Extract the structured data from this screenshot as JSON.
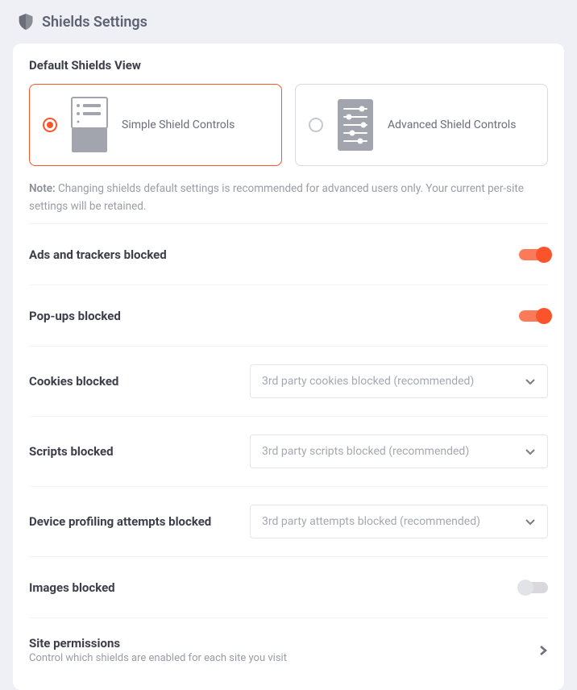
{
  "header": {
    "title": "Shields Settings"
  },
  "viewSection": {
    "title": "Default Shields View",
    "options": {
      "simple": "Simple Shield Controls",
      "advanced": "Advanced Shield Controls"
    },
    "noteLabel": "Note:",
    "noteText": " Changing shields default settings is recommended for advanced users only. Your current per-site settings will be retained."
  },
  "rows": {
    "ads": {
      "label": "Ads and trackers blocked",
      "on": true
    },
    "popups": {
      "label": "Pop-ups blocked",
      "on": true
    },
    "cookies": {
      "label": "Cookies blocked",
      "value": "3rd party cookies blocked (recommended)"
    },
    "scripts": {
      "label": "Scripts blocked",
      "value": "3rd party scripts blocked (recommended)"
    },
    "device": {
      "label": "Device profiling attempts blocked",
      "value": "3rd party attempts blocked (recommended)"
    },
    "images": {
      "label": "Images blocked",
      "on": false
    },
    "sitePermissions": {
      "label": "Site permissions",
      "sub": "Control which shields are enabled for each site you visit"
    }
  }
}
